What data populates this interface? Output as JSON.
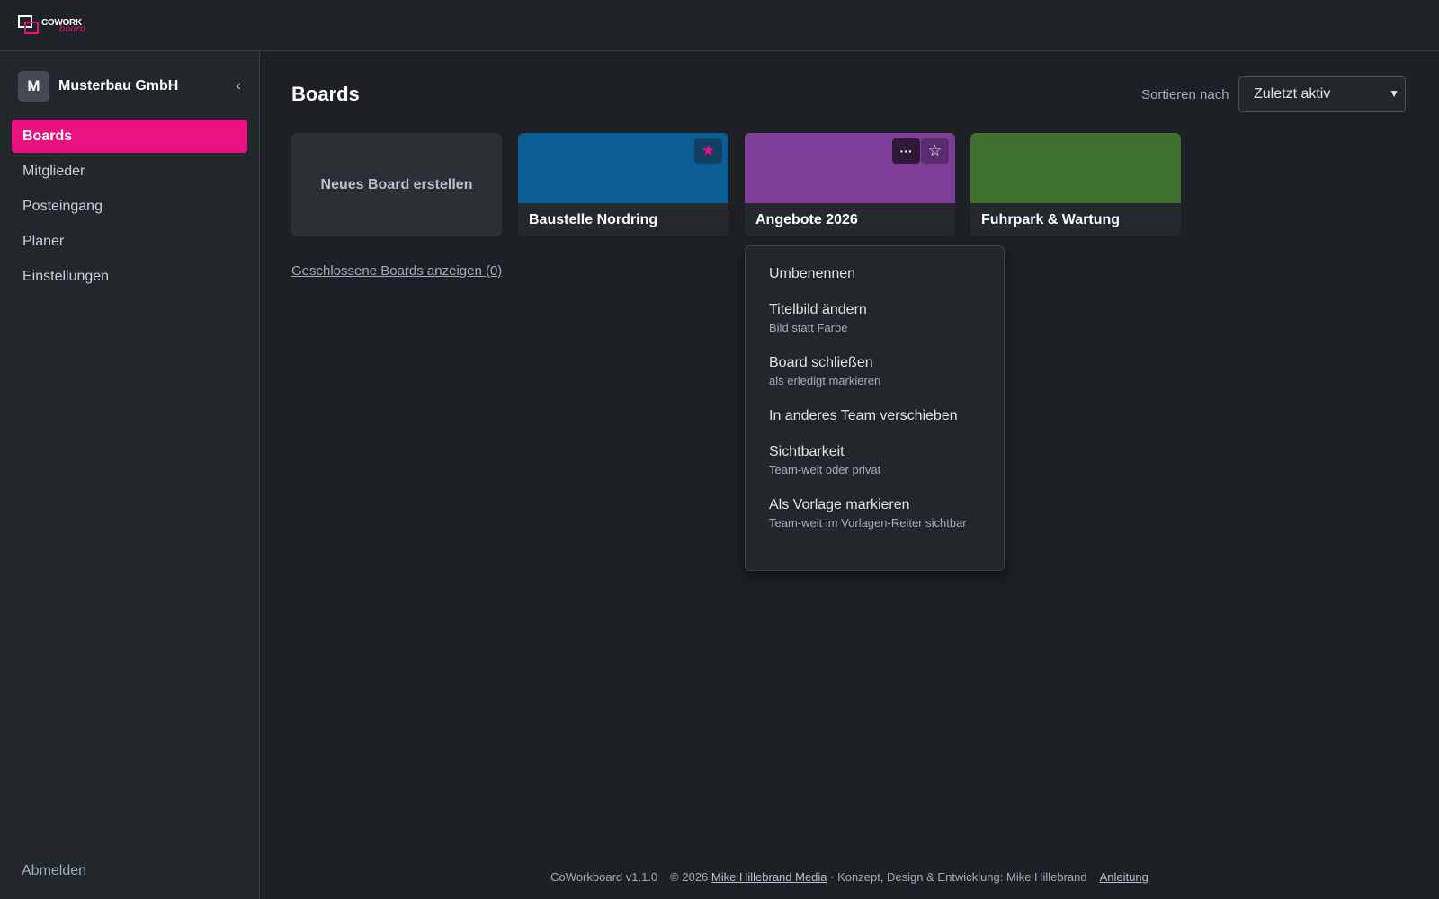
{
  "app": {
    "logo_word1": "COWORK",
    "logo_word2": "board"
  },
  "sidebar": {
    "team_initial": "M",
    "team_name": "Musterbau GmbH",
    "collapse_icon": "‹",
    "items": [
      {
        "label": "Boards",
        "active": true
      },
      {
        "label": "Mitglieder",
        "active": false
      },
      {
        "label": "Posteingang",
        "active": false
      },
      {
        "label": "Planer",
        "active": false
      },
      {
        "label": "Einstellungen",
        "active": false
      }
    ],
    "logout_label": "Abmelden"
  },
  "main": {
    "title": "Boards",
    "sort_label": "Sortieren nach",
    "sort_selected": "Zuletzt aktiv",
    "new_board_label": "Neues Board erstellen",
    "boards": [
      {
        "title": "Baustelle Nordring",
        "color": "#0c5d94",
        "starred": true
      },
      {
        "title": "Angebote 2026",
        "color": "#7f3f98",
        "starred": false
      },
      {
        "title": "Fuhrpark & Wartung",
        "color": "#3f702e",
        "starred": false
      }
    ],
    "closed_boards_link": "Geschlossene Boards anzeigen (0)",
    "more_icon": "···",
    "star_filled_icon": "★",
    "star_outline_icon": "☆"
  },
  "menu": {
    "items": [
      {
        "label": "Umbenennen",
        "sub": ""
      },
      {
        "label": "Titelbild ändern",
        "sub": "Bild statt Farbe"
      },
      {
        "label": "Board schließen",
        "sub": "als erledigt markieren"
      },
      {
        "label": "In anderes Team verschieben",
        "sub": ""
      },
      {
        "label": "Sichtbarkeit",
        "sub": "Team-weit oder privat"
      },
      {
        "label": "Als Vorlage markieren",
        "sub": "Team-weit im Vorlagen-Reiter sichtbar"
      }
    ]
  },
  "footer": {
    "version": "CoWorkboard v1.1.0",
    "copyright_prefix": "© 2026",
    "company_link": "Mike Hillebrand Media",
    "credits": "· Konzept, Design & Entwicklung: Mike Hillebrand",
    "guide_link": "Anleitung"
  },
  "colors": {
    "accent": "#e8117f",
    "background": "#1d2125",
    "sidebar": "#22272b"
  }
}
